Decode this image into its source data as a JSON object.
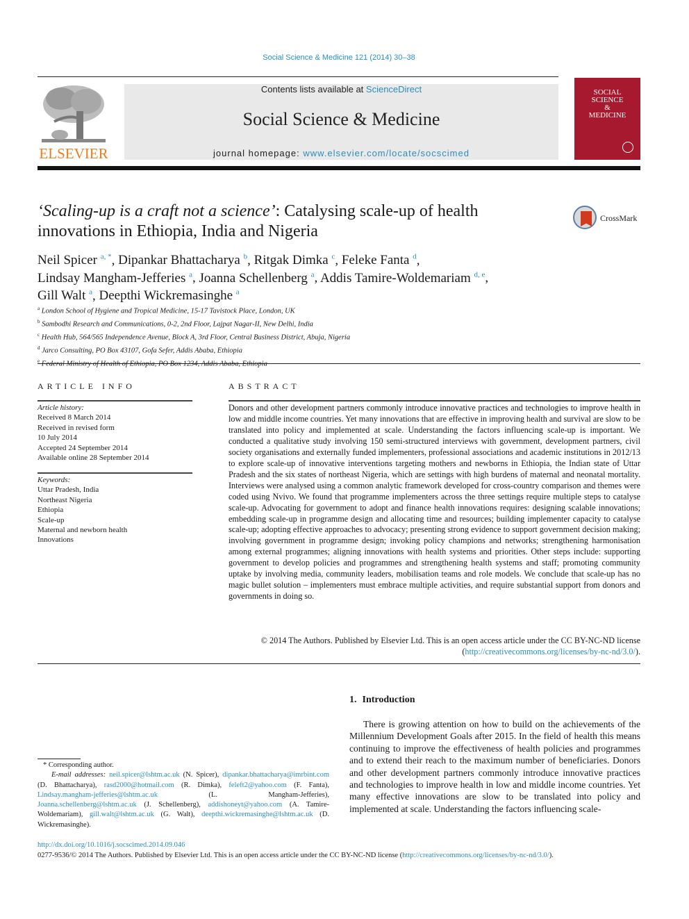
{
  "header": {
    "citation": "Social Science & Medicine 121 (2014) 30–38",
    "contents_prefix": "Contents lists available at ",
    "contents_link": "ScienceDirect",
    "journal_name": "Social Science & Medicine",
    "homepage_prefix": "journal homepage: ",
    "homepage_link": "www.elsevier.com/locate/socscimed",
    "publisher_logo_text": "ELSEVIER",
    "cover_title_lines": [
      "SOCIAL",
      "SCIENCE",
      "&",
      "MEDICINE"
    ],
    "crossmark_label": "CrossMark",
    "colors": {
      "link": "#2a8dbd",
      "elsevier_orange": "#f07d1b",
      "cover_red": "#a6192e"
    }
  },
  "article": {
    "title_italic": "‘Scaling-up is a craft not a science’",
    "title_rest": ": Catalysing scale-up of health innovations in Ethiopia, India and Nigeria",
    "authors": [
      {
        "name": "Neil Spicer",
        "aff": "a, *"
      },
      {
        "name": "Dipankar Bhattacharya",
        "aff": "b"
      },
      {
        "name": "Ritgak Dimka",
        "aff": "c"
      },
      {
        "name": "Feleke Fanta",
        "aff": "d"
      },
      {
        "name": "Lindsay Mangham-Jefferies",
        "aff": "a"
      },
      {
        "name": "Joanna Schellenberg",
        "aff": "a"
      },
      {
        "name": "Addis Tamire-Woldemariam",
        "aff": "d, e"
      },
      {
        "name": "Gill Walt",
        "aff": "a"
      },
      {
        "name": "Deepthi Wickremasinghe",
        "aff": "a"
      }
    ],
    "affiliations": [
      {
        "key": "a",
        "text": "London School of Hygiene and Tropical Medicine, 15-17 Tavistock Place, London, UK"
      },
      {
        "key": "b",
        "text": "Sambodhi Research and Communications, 0-2, 2nd Floor, Lajpat Nagar-II, New Delhi, India"
      },
      {
        "key": "c",
        "text": "Health Hub, 564/565 Independence Avenue, Block A, 3rd Floor, Central Business District, Abuja, Nigeria"
      },
      {
        "key": "d",
        "text": "Jarco Consulting, PO Box 43107, Gofa Sefer, Addis Ababa, Ethiopia"
      },
      {
        "key": "e",
        "text": "Federal Ministry of Health of Ethiopia, PO Box 1234, Addis Ababa, Ethiopia"
      }
    ]
  },
  "article_info": {
    "heading": "ARTICLE INFO",
    "history_label": "Article history:",
    "history": [
      "Received 8 March 2014",
      "Received in revised form",
      "10 July 2014",
      "Accepted 24 September 2014",
      "Available online 28 September 2014"
    ],
    "keywords_label": "Keywords:",
    "keywords": [
      "Uttar Pradesh, India",
      "Northeast Nigeria",
      "Ethiopia",
      "Scale-up",
      "Maternal and newborn health",
      "Innovations"
    ]
  },
  "abstract": {
    "heading": "ABSTRACT",
    "text": "Donors and other development partners commonly introduce innovative practices and technologies to improve health in low and middle income countries. Yet many innovations that are effective in improving health and survival are slow to be translated into policy and implemented at scale. Under­standing the factors influencing scale-up is important. We conducted a qualitative study involving 150 semi-structured interviews with government, development partners, civil society organisations and externally funded implementers, professional associations and academic institutions in 2012/13 to explore scale-up of innovative interventions targeting mothers and newborns in Ethiopia, the Indian state of Uttar Pradesh and the six states of northeast Nigeria, which are settings with high burdens of maternal and neonatal mortality. Interviews were analysed using a common analytic framework developed for cross-country comparison and themes were coded using Nvivo. We found that programme implementers across the three settings require multiple steps to catalyse scale-up. Advocating for gov­ernment to adopt and finance health innovations requires: designing scalable innovations; embedding scale-up in programme design and allocating time and resources; building implementer capacity to catalyse scale-up; adopting effective approaches to advocacy; presenting strong evidence to support government decision making; involving government in programme design; invoking policy champions and networks; strengthening harmonisation among external programmes; aligning innovations with health systems and priorities. Other steps include: supporting government to develop policies and programmes and strengthening health systems and staff; promoting community uptake by involving media, community leaders, mobilisation teams and role models. We conclude that scale-up has no magic bullet solution – implementers must embrace multiple activities, and require substantial support from donors and governments in doing so.",
    "copyright_prefix": "© 2014 The Authors. Published by Elsevier Ltd. This is an open access article under the CC BY-NC-ND license (",
    "copyright_link": "http://creativecommons.org/licenses/by-nc-nd/3.0/",
    "copyright_suffix": ")."
  },
  "introduction": {
    "number": "1.",
    "heading": "Introduction",
    "text": "There is growing attention on how to build on the achievements of the Millennium Development Goals after 2015. In the field of health this means continuing to improve the effectiveness of health policies and programmes and to extend their reach to the maximum number of beneficiaries. Donors and other development partners commonly introduce innovative practices and technolo­gies to improve health in low and middle income countries. Yet many effective innovations are slow to be translated into policy and implemented at scale. Understanding the factors influencing scale-"
  },
  "footnotes": {
    "corresponding": "* Corresponding author.",
    "email_label": "E-mail addresses: ",
    "emails": [
      {
        "email": "neil.spicer@lshtm.ac.uk",
        "who": " (N. Spicer), "
      },
      {
        "email": "dipankar.bhattacharya@imrbint.com",
        "who": " (D. Bhattacharya), "
      },
      {
        "email": "rasd2000@hotmail.com",
        "who": " (R. Dimka), "
      },
      {
        "email": "feleft2@yahoo.com",
        "who": " (F. Fanta), "
      },
      {
        "email": "Lindsay.mangham-jefferies@lshtm.ac.uk",
        "who": " (L. Mangham-Jefferies), "
      },
      {
        "email": "Joanna.schellenberg@lshtm.ac.uk",
        "who": " (J. Schellenberg), "
      },
      {
        "email": "addishoneyt@yahoo.com",
        "who": " (A. Tamire-Woldemariam), "
      },
      {
        "email": "gill.walt@lshtm.ac.uk",
        "who": " (G. Walt), "
      },
      {
        "email": "deepthi.wickremasinghe@lshtm.ac.uk",
        "who": " (D. Wickremasinghe)."
      }
    ]
  },
  "footer": {
    "doi": "http://dx.doi.org/10.1016/j.socscimed.2014.09.046",
    "license_prefix": "0277-9536/© 2014 The Authors. Published by Elsevier Ltd. This is an open access article under the CC BY-NC-ND license (",
    "license_link": "http://creativecommons.org/licenses/by-nc-nd/3.0/",
    "license_suffix": ")."
  }
}
